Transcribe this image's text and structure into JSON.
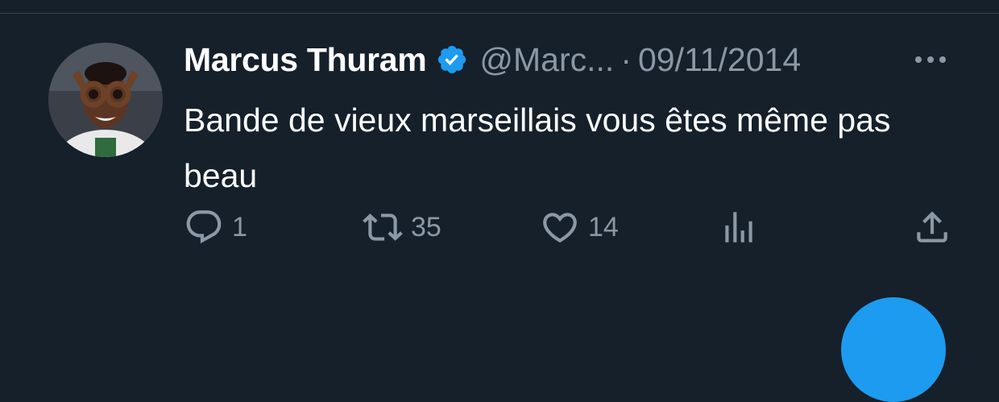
{
  "tweet": {
    "author": {
      "name": "Marcus Thuram",
      "handle": "@Marc...",
      "verified": true
    },
    "separator": "·",
    "date": "09/11/2014",
    "text": "Bande de vieux marseillais vous êtes même pas beau",
    "stats": {
      "replies": "1",
      "retweets": "35",
      "likes": "14"
    }
  },
  "icons": {
    "reply": "speech-bubble-icon",
    "retweet": "retweet-icon",
    "like": "heart-icon",
    "views": "bar-chart-icon",
    "share": "share-icon",
    "more": "more-dots-icon",
    "verified": "verified-badge-icon"
  },
  "colors": {
    "background": "#15202b",
    "text_primary": "#ffffff",
    "text_secondary": "#8b98a5",
    "accent": "#1d9bf0",
    "divider": "#38444d"
  }
}
